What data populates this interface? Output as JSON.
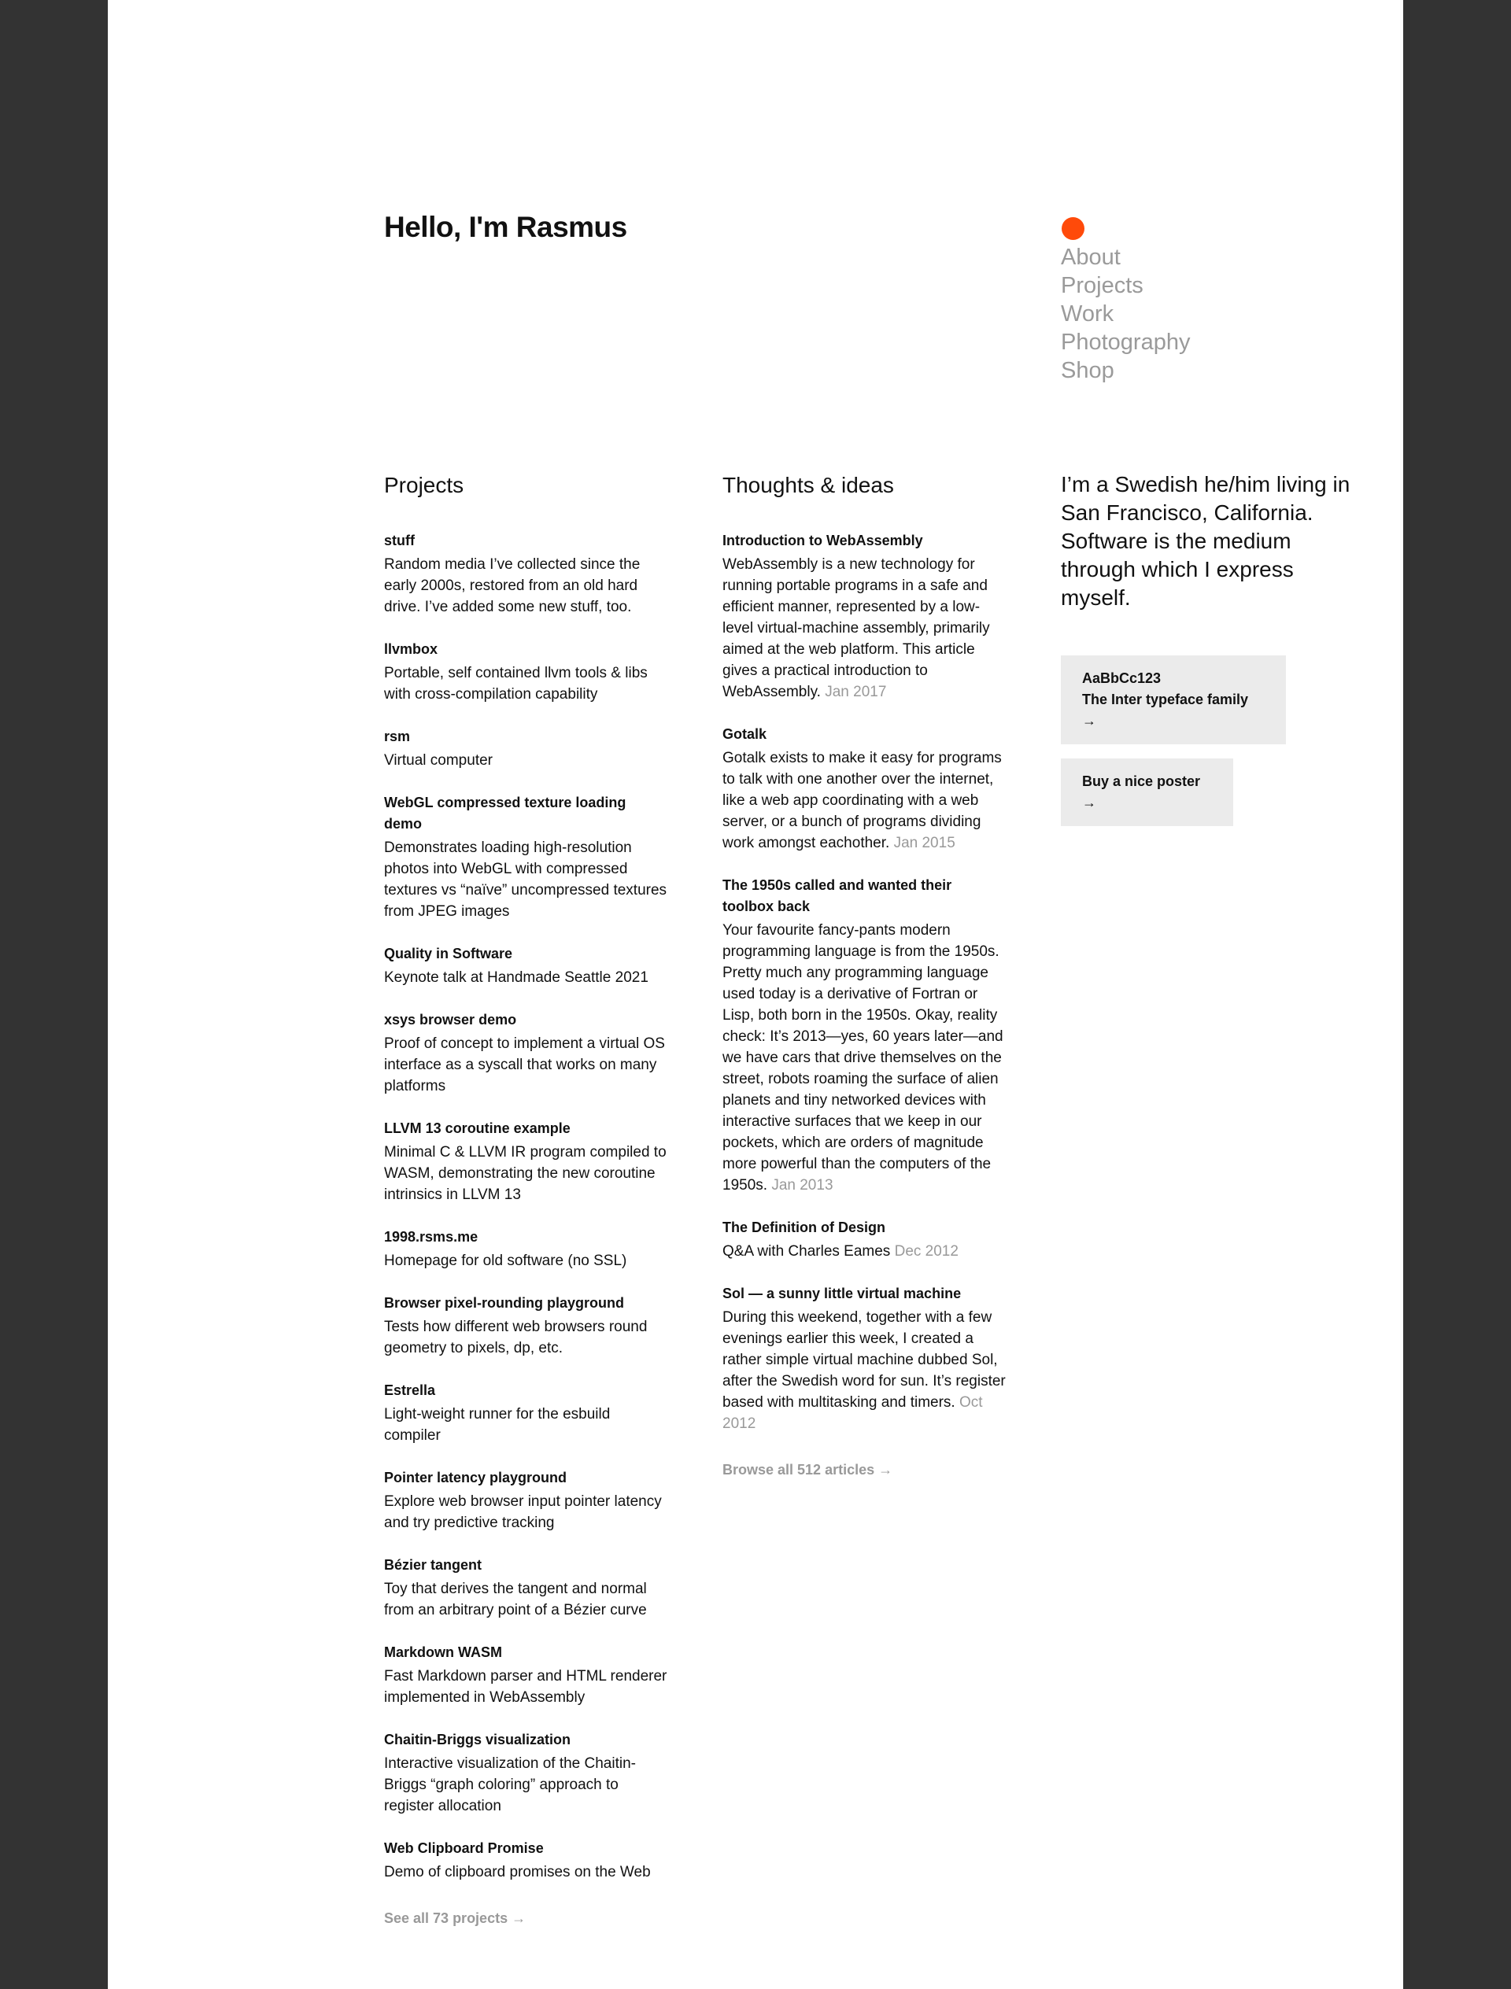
{
  "header": {
    "greeting": "Hello, I'm Rasmus",
    "nav": [
      "About",
      "Projects",
      "Work",
      "Photography",
      "Shop"
    ]
  },
  "projects": {
    "heading": "Projects",
    "items": [
      {
        "title": "stuff",
        "desc": "Random media I’ve collected since the early 2000s, restored from an old hard drive. I’ve added some new stuff, too."
      },
      {
        "title": "llvmbox",
        "desc": "Portable, self contained llvm tools & libs with cross-compilation capability"
      },
      {
        "title": "rsm",
        "desc": "Virtual computer"
      },
      {
        "title": "WebGL compressed texture loading demo",
        "desc": "Demonstrates loading high-resolution photos into WebGL with compressed textures vs “naïve” uncompressed textures from JPEG images"
      },
      {
        "title": "Quality in Software",
        "desc": "Keynote talk at Handmade Seattle 2021"
      },
      {
        "title": "xsys browser demo",
        "desc": "Proof of concept to implement a virtual OS interface as a syscall that works on many platforms"
      },
      {
        "title": "LLVM 13 coroutine example",
        "desc": "Minimal C & LLVM IR program compiled to WASM, demonstrating the new coroutine intrinsics in LLVM 13"
      },
      {
        "title": "1998.rsms.me",
        "desc": "Homepage for old software (no SSL)"
      },
      {
        "title": "Browser pixel-rounding playground",
        "desc": "Tests how different web browsers round geometry to pixels, dp, etc."
      },
      {
        "title": "Estrella",
        "desc": "Light-weight runner for the esbuild compiler"
      },
      {
        "title": "Pointer latency playground",
        "desc": "Explore web browser input pointer latency and try predictive tracking"
      },
      {
        "title": "Bézier tangent",
        "desc": "Toy that derives the tangent and normal from an arbitrary point of a Bézier curve"
      },
      {
        "title": "Markdown WASM",
        "desc": "Fast Markdown parser and HTML renderer implemented in WebAssembly"
      },
      {
        "title": "Chaitin-Briggs visualization",
        "desc": "Interactive visualization of the Chaitin-Briggs “graph coloring” approach to register allocation"
      },
      {
        "title": "Web Clipboard Promise",
        "desc": "Demo of clipboard promises on the Web"
      }
    ],
    "more": "See all 73 projects →"
  },
  "thoughts": {
    "heading": "Thoughts & ideas",
    "items": [
      {
        "title": "Introduction to WebAssembly",
        "desc": "WebAssembly is a new technology for running portable programs in a safe and efficient manner, represented by a low-level virtual-machine assembly, primarily aimed at the web platform. This article gives a practical introduction to WebAssembly.",
        "date": "Jan 2017"
      },
      {
        "title": "Gotalk",
        "desc": "Gotalk exists to make it easy for programs to talk with one another over the internet, like a web app coordinating with a web server, or a bunch of programs dividing work amongst eachother.",
        "date": "Jan 2015"
      },
      {
        "title": "The 1950s called and wanted their toolbox back",
        "desc": "Your favourite fancy-pants modern programming language is from the 1950s. Pretty much any programming language used today is a derivative of Fortran or Lisp, both born in the 1950s. Okay, reality check: It’s 2013—yes, 60 years later—and we have cars that drive themselves on the street, robots roaming the surface of alien planets and tiny networked devices with interactive surfaces that we keep in our pockets, which are orders of magnitude more powerful than the computers of the 1950s.",
        "date": "Jan 2013"
      },
      {
        "title": "The Definition of Design",
        "desc": "Q&A with Charles Eames",
        "date": "Dec 2012"
      },
      {
        "title": "Sol — a sunny little virtual machine",
        "desc": "During this weekend, together with a few evenings earlier this week, I created a rather simple virtual machine dubbed Sol, after the Swedish word for sun. It’s register based with multitasking and timers.",
        "date": "Oct 2012"
      }
    ],
    "more": "Browse all 512 articles →"
  },
  "about": {
    "intro": "I’m a Swedish he/him living in San Francisco, California. Software is the medium through which I express myself.",
    "typeface_sample": "AaBbCc123",
    "typeface_label": "The Inter typeface family →",
    "poster_label": "Buy a nice poster →"
  },
  "colors": {
    "accent_dot": "#ff4a0a",
    "page_background": "#ffffff",
    "frame_background": "#333333",
    "muted_text": "#999999",
    "button_background": "#ebebeb"
  }
}
